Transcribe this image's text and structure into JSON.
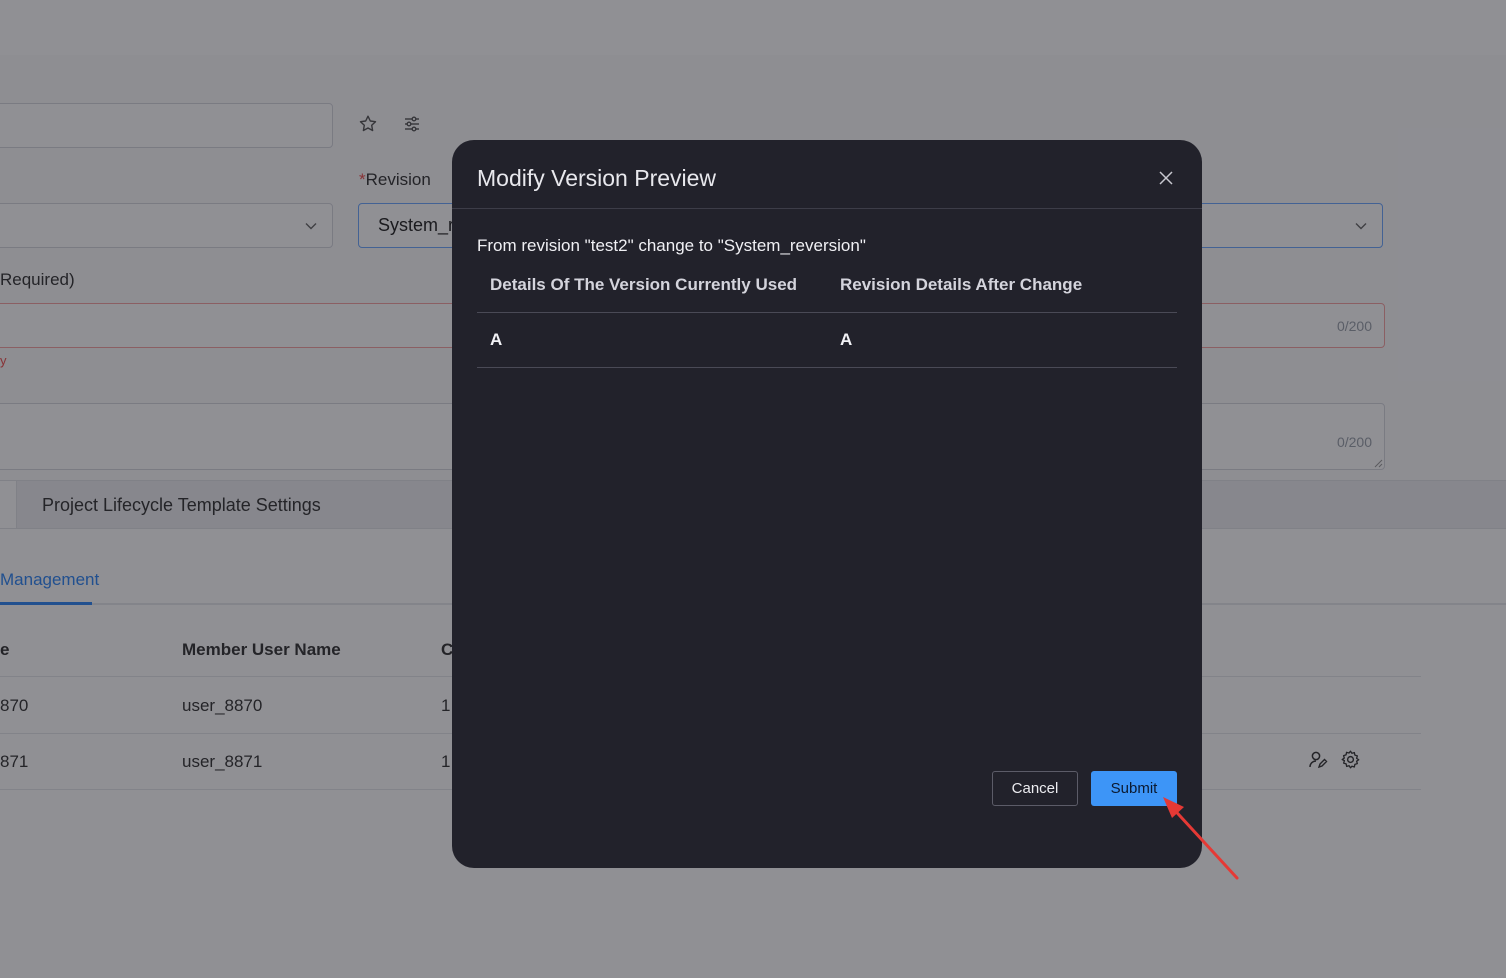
{
  "background": {
    "form": {
      "revision_label": "Revision",
      "revision_required_mark": "*",
      "revision_value": "System_r",
      "required_label_fragment": "Required)",
      "error_fragment": "y",
      "field1_counter": "0/200",
      "field2_counter": "0/200"
    },
    "section_tab": "Project Lifecycle Template Settings",
    "subtab_active": "Management",
    "table": {
      "headers": [
        "e",
        "Member User Name",
        "C"
      ],
      "rows": [
        {
          "col1": "870",
          "user": "user_8870",
          "col3": "1"
        },
        {
          "col1": "871",
          "user": "user_8871",
          "col3": "1"
        }
      ],
      "row_action_icons": [
        "user-edit-icon",
        "gear-icon"
      ]
    }
  },
  "modal": {
    "title": "Modify Version Preview",
    "description": "From revision \"test2\" change to \"System_reversion\"",
    "columns": [
      "Details Of The Version Currently Used",
      "Revision Details After Change"
    ],
    "rows": [
      {
        "current": "A",
        "after": "A"
      }
    ],
    "cancel_label": "Cancel",
    "submit_label": "Submit"
  },
  "colors": {
    "accent": "#3d95f7",
    "modal_bg": "#22222b",
    "error": "#f0504f",
    "annotation_arrow": "#e53935"
  }
}
